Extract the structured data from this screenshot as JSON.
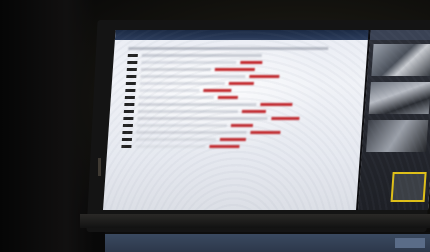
{
  "photo": {
    "subject": "monitor-screen",
    "window_title": "",
    "screen_text_lines": []
  }
}
